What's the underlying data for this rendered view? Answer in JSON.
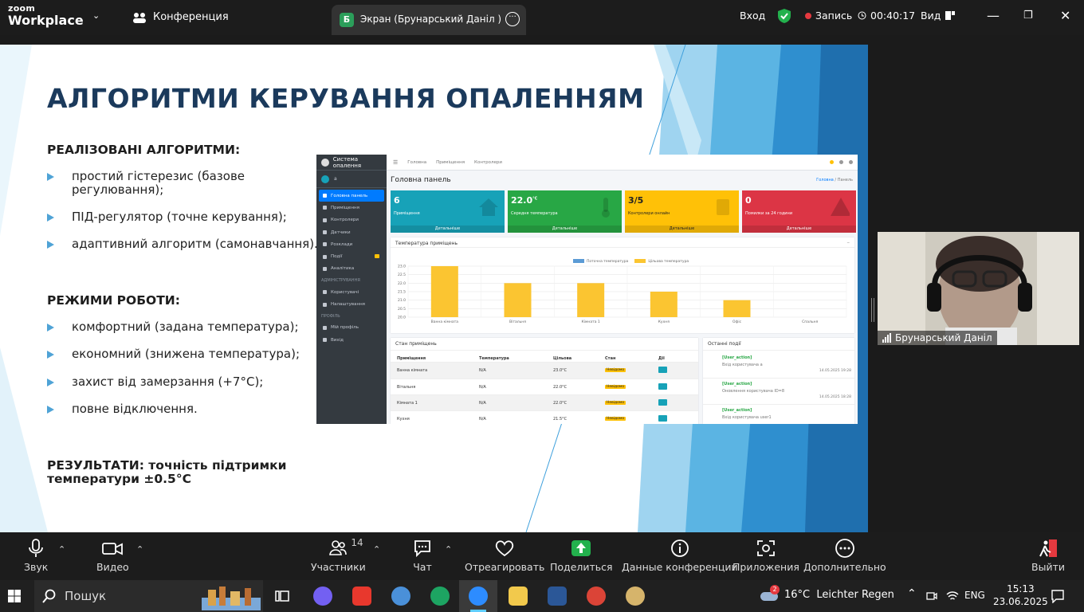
{
  "topbar": {
    "logo_top": "zoom",
    "logo_bottom": "Workplace",
    "conference_label": "Конференция",
    "tab_badge": "Б",
    "tab_title": "Экран (Брунарський Даніл )",
    "signin": "Вход",
    "record_label": "Запись",
    "timer": "00:40:17",
    "view_label": "Вид"
  },
  "slide": {
    "title": "АЛГОРИТМИ КЕРУВАННЯ ОПАЛЕННЯМ",
    "algorithms_heading": "РЕАЛІЗОВАНІ АЛГОРИТМИ:",
    "algorithms": [
      "простий гістерезис (базове регулювання);",
      "ПІД-регулятор (точне керування);",
      "адаптивний алгоритм (самонавчання)."
    ],
    "modes_heading": "РЕЖИМИ РОБОТИ:",
    "modes": [
      "комфортний (задана температура);",
      "економний (знижена температура);",
      "захист від замерзання (+7°C);",
      "повне відключення."
    ],
    "result_line1": "РЕЗУЛЬТАТИ: точність підтримки",
    "result_line2": "температури ±0.5°C"
  },
  "dashboard": {
    "brand": "Система опалення",
    "user": "а",
    "nav": [
      "Головна панель",
      "Приміщення",
      "Контролери",
      "Датчики",
      "Розклади",
      "Події",
      "Аналітика"
    ],
    "admin_heading": "АДМІНІСТРУВАННЯ",
    "admin_nav": [
      "Користувачі",
      "Налаштування"
    ],
    "profile_heading": "ПРОФІЛЬ",
    "profile_nav": [
      "Мій профіль",
      "Вихід"
    ],
    "top_links": [
      "Головна",
      "Приміщення",
      "Контролери"
    ],
    "page_title": "Головна панель",
    "breadcrumb_home": "Головна",
    "breadcrumb_sep": "/",
    "breadcrumb_current": "Панель",
    "boxes": [
      {
        "num": "6",
        "label": "Приміщення",
        "foot": "Детальніше",
        "color": "#17a2b8"
      },
      {
        "num": "22.0",
        "sup": "°C",
        "label": "Середня температура",
        "foot": "Детальніше",
        "color": "#28a745"
      },
      {
        "num": "3/5",
        "label": "Контролери онлайн",
        "foot": "Детальніше",
        "color": "#ffc107"
      },
      {
        "num": "0",
        "label": "Помилки за 24 години",
        "foot": "Детальніше",
        "color": "#dc3545"
      }
    ],
    "table_title": "Стан приміщень",
    "table_headers": [
      "Приміщення",
      "Температура",
      "Цільова",
      "Стан",
      "Дії"
    ],
    "table_rows": [
      {
        "room": "Ванна кімната",
        "temp": "N/A",
        "target": "23.0°C",
        "state": "Невідомо"
      },
      {
        "room": "Вітальня",
        "temp": "N/A",
        "target": "22.0°C",
        "state": "Невідомо"
      },
      {
        "room": "Кімната 1",
        "temp": "N/A",
        "target": "22.0°C",
        "state": "Невідомо"
      },
      {
        "room": "Кухня",
        "temp": "N/A",
        "target": "21.5°C",
        "state": "Невідомо"
      }
    ],
    "events_title": "Останні події",
    "events": [
      {
        "type": "[User_action]",
        "desc": "Вхід користувача а",
        "date": "14.05.2025 19:28"
      },
      {
        "type": "[User_action]",
        "desc": "Оновлення користувача ID=8",
        "date": "14.05.2025 18:28"
      },
      {
        "type": "[User_action]",
        "desc": "Вхід користувача user1",
        "date": ""
      }
    ]
  },
  "chart_data": {
    "type": "bar",
    "title": "Температура приміщень",
    "categories": [
      "Ванна кімната",
      "Вітальня",
      "Кімната 1",
      "Кухня",
      "Офіс",
      "Спальня"
    ],
    "series": [
      {
        "name": "Поточна температура",
        "values": [
          null,
          null,
          null,
          null,
          null,
          null
        ],
        "color": "#5b9bd5"
      },
      {
        "name": "Цільова температура",
        "values": [
          23.0,
          22.0,
          22.0,
          21.5,
          21.0,
          null
        ],
        "color": "#fbc531"
      }
    ],
    "y_ticks": [
      "23.0",
      "22.5",
      "22.0",
      "21.5",
      "21.0",
      "20.5",
      "20.0"
    ],
    "ylim": [
      20.0,
      23.0
    ],
    "grid": true,
    "legend": "top-center"
  },
  "video": {
    "participant_name": "Брунарський Даніл"
  },
  "toolbar": {
    "audio": "Звук",
    "video": "Видео",
    "participants": "Участники",
    "participants_count": "14",
    "chat": "Чат",
    "react": "Отреагировать",
    "share": "Поделиться",
    "info": "Данные конференции",
    "apps": "Приложения",
    "more": "Дополнительно",
    "leave": "Выйти"
  },
  "taskbar": {
    "search": "Пошук",
    "weather": "16°C  Leichter Regen",
    "weather_badge": "2",
    "lang": "ENG",
    "time": "15:13",
    "date": "23.06.2025"
  }
}
